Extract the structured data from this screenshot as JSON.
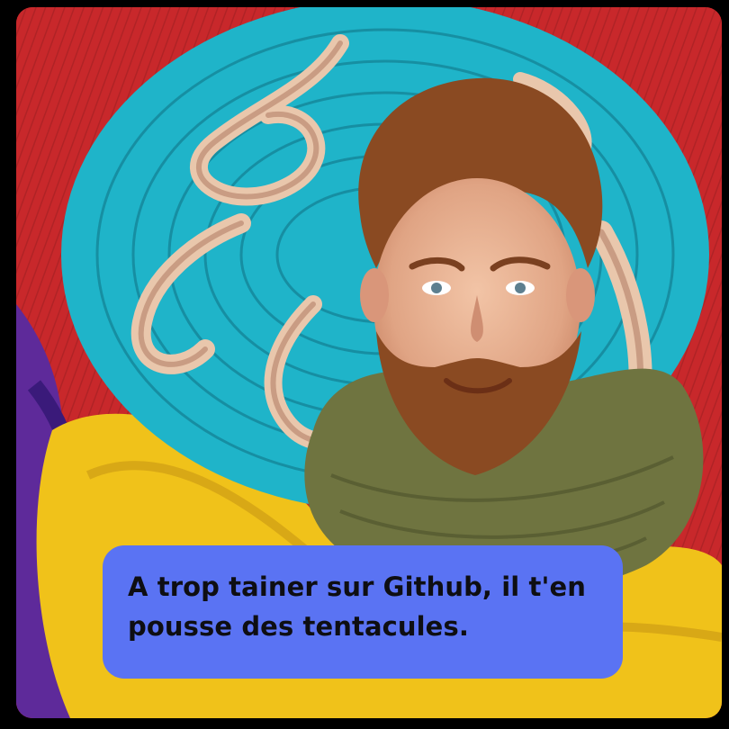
{
  "image": {
    "subject": "face-portrait",
    "palette": {
      "frame_bg": "#000000",
      "felt_red": "#c8282b",
      "felt_turquoise": "#1fb4c9",
      "felt_yellow": "#f0c21a",
      "felt_purple": "#5e2a9a",
      "scarf_olive": "#6f7440",
      "tentacle": "#e9c7ac",
      "hair_beard": "#8a4a22"
    }
  },
  "caption": {
    "line1": "A trop tainer sur Github, il t'en",
    "line2": "pousse des tentacules.",
    "bg_color": "#5a73f3"
  }
}
